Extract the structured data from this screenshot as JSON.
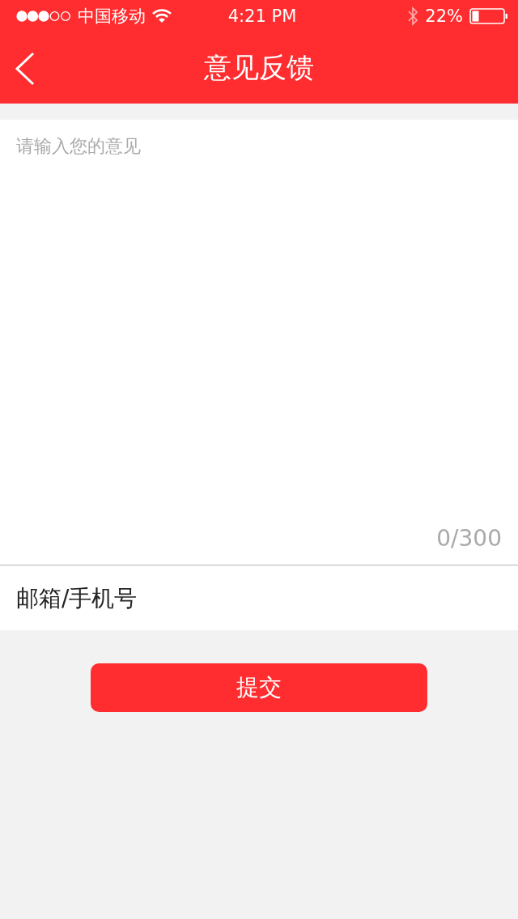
{
  "status_bar": {
    "carrier": "中国移动",
    "time": "4:21 PM",
    "battery": "22%"
  },
  "nav_bar": {
    "title": "意见反馈"
  },
  "feedback": {
    "placeholder": "请输入您的意见",
    "counter": "0/300"
  },
  "contact": {
    "placeholder": "邮箱/手机号"
  },
  "submit_button": "提交"
}
